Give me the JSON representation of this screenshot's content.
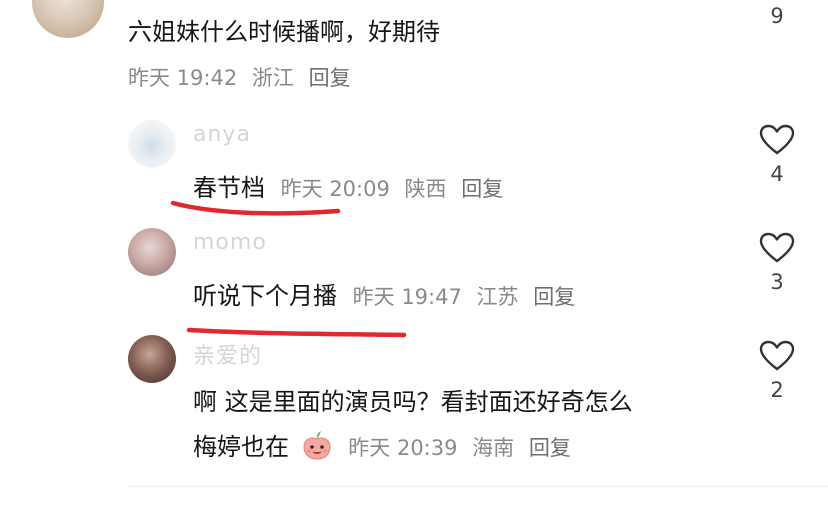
{
  "colors": {
    "underline": "#e0282e",
    "text": "#161616",
    "meta": "#8a8a8a"
  },
  "top_comment": {
    "text": "六姐妹什么时候播啊，好期待",
    "date": "昨天 19:42",
    "location": "浙江",
    "reply_label": "回复",
    "likes": "9"
  },
  "replies": [
    {
      "username": "anya",
      "text": "春节档",
      "date": "昨天 20:09",
      "location": "陕西",
      "reply_label": "回复",
      "likes": "4",
      "underlined": true
    },
    {
      "username": "momo",
      "text": "听说下个月播",
      "date": "昨天 19:47",
      "location": "江苏",
      "reply_label": "回复",
      "likes": "3",
      "underlined": true
    },
    {
      "username": "亲爱的",
      "text_line1": "啊 这是里面的演员吗？看封面还好奇怎么",
      "text_line2": "梅婷也在",
      "emoji_icon": "peach-face-emoji-icon",
      "date": "昨天 20:39",
      "location": "海南",
      "reply_label": "回复",
      "likes": "2"
    }
  ],
  "icons": {
    "like": "heart-outline-icon"
  }
}
